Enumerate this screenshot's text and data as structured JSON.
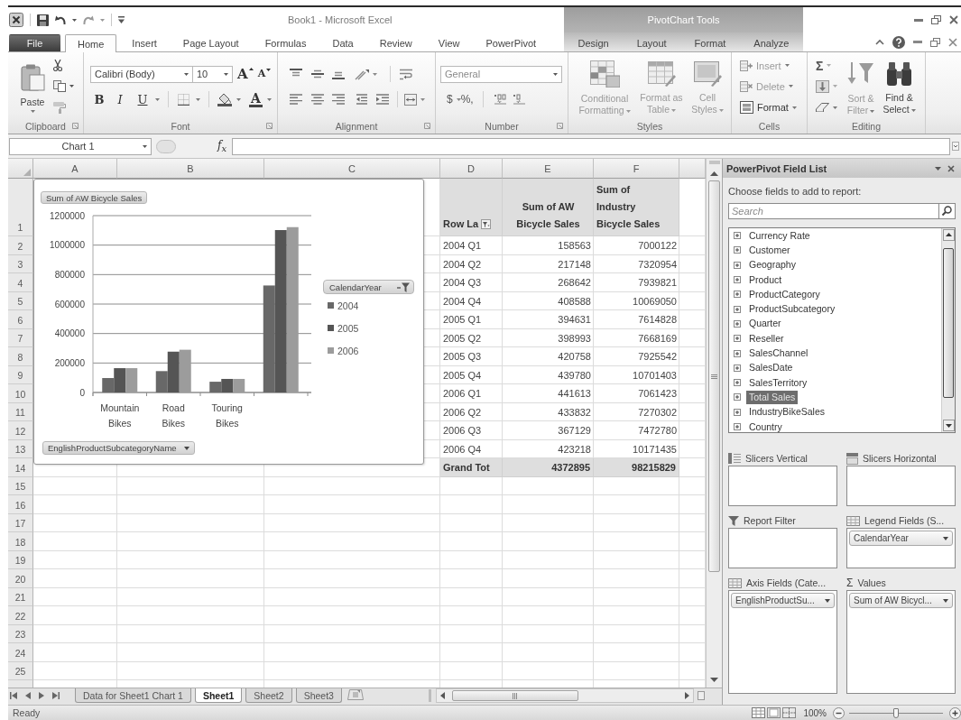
{
  "title_bar": {
    "title": "Book1 - Microsoft Excel",
    "context_header": "PivotChart Tools"
  },
  "ribbon_tabs": [
    {
      "label": "File",
      "kind": "file",
      "selected": false
    },
    {
      "label": "Home",
      "kind": "standard",
      "selected": true
    },
    {
      "label": "Insert",
      "kind": "standard",
      "selected": false
    },
    {
      "label": "Page Layout",
      "kind": "standard",
      "selected": false
    },
    {
      "label": "Formulas",
      "kind": "standard",
      "selected": false
    },
    {
      "label": "Data",
      "kind": "standard",
      "selected": false
    },
    {
      "label": "Review",
      "kind": "standard",
      "selected": false
    },
    {
      "label": "View",
      "kind": "standard",
      "selected": false
    },
    {
      "label": "PowerPivot",
      "kind": "standard",
      "selected": false
    },
    {
      "label": "Design",
      "kind": "contextual",
      "selected": false
    },
    {
      "label": "Layout",
      "kind": "contextual",
      "selected": false
    },
    {
      "label": "Format",
      "kind": "contextual",
      "selected": false
    },
    {
      "label": "Analyze",
      "kind": "contextual",
      "selected": false
    }
  ],
  "ribbon": {
    "clipboard": {
      "label": "Clipboard",
      "paste": "Paste"
    },
    "font": {
      "label": "Font",
      "font_name": "Calibri (Body)",
      "font_size": "10",
      "grow": "A",
      "shrink": "A",
      "bold": "B",
      "italic": "I",
      "underline": "U",
      "font_color": "A"
    },
    "alignment": {
      "label": "Alignment"
    },
    "number": {
      "label": "Number",
      "format": "General",
      "currency": "$",
      "percent": "%",
      "comma": ","
    },
    "styles": {
      "label": "Styles",
      "buttons": [
        {
          "label": "Conditional Formatting",
          "kind": "conditional",
          "disabled": true
        },
        {
          "label": "Format as Table",
          "kind": "table",
          "disabled": true
        },
        {
          "label": "Cell Styles",
          "kind": "cell_styles",
          "disabled": true
        }
      ]
    },
    "cells": {
      "label": "Cells",
      "buttons": [
        {
          "label": "Insert",
          "kind": "insert",
          "disabled": true
        },
        {
          "label": "Delete",
          "kind": "delete",
          "disabled": true
        },
        {
          "label": "Format",
          "kind": "format",
          "disabled": false
        }
      ]
    },
    "editing": {
      "label": "Editing",
      "autosum": "Σ",
      "buttons": [
        {
          "label": "Sort & Filter",
          "kind": "sort",
          "disabled": true
        },
        {
          "label": "Find & Select",
          "kind": "find",
          "disabled": false
        }
      ]
    }
  },
  "formula_bar": {
    "name_box": "Chart 1",
    "function_button": "f$_{x}$"
  },
  "sheet": {
    "columns": [
      "A",
      "B",
      "C",
      "D",
      "E",
      "F"
    ],
    "row_numbers": [
      "1",
      "2",
      "3",
      "4",
      "5",
      "6",
      "7",
      "8",
      "9",
      "10",
      "11",
      "12",
      "13",
      "14",
      "15",
      "16",
      "17",
      "18",
      "19",
      "20",
      "21",
      "22",
      "23",
      "24",
      "25"
    ]
  },
  "chart": {
    "value_field_button": "Sum of AW Bicycle Sales",
    "axis_field_button": "EnglishProductSubcategoryName",
    "chart_data": {
      "type": "bar",
      "categories": [
        "Mountain Bikes",
        "Road Bikes",
        "Touring Bikes",
        null
      ],
      "series": [
        {
          "name": "2004",
          "color": "#686868",
          "values": [
            98000,
            145000,
            73000,
            726000
          ]
        },
        {
          "name": "2005",
          "color": "#555555",
          "values": [
            165000,
            277000,
            92000,
            1102000
          ]
        },
        {
          "name": "2006",
          "color": "#9c9c9c",
          "values": [
            165000,
            290000,
            92000,
            1122000
          ]
        }
      ],
      "ylim": [
        0,
        1200000
      ],
      "yticks": [
        0,
        200000,
        400000,
        600000,
        800000,
        1000000,
        1200000
      ],
      "grid": true,
      "legend": "right",
      "legend_title": "CalendarYear"
    }
  },
  "pivot_table": {
    "headers": [
      "Row La",
      "Sum of AW Bicycle Sales",
      "Sum of Industry Bicycle Sales"
    ],
    "rows": [
      {
        "label": "2004 Q1",
        "values": [
          "158563",
          "7000122"
        ]
      },
      {
        "label": "2004 Q2",
        "values": [
          "217148",
          "7320954"
        ]
      },
      {
        "label": "2004 Q3",
        "values": [
          "268642",
          "7939821"
        ]
      },
      {
        "label": "2004 Q4",
        "values": [
          "408588",
          "10069050"
        ]
      },
      {
        "label": "2005 Q1",
        "values": [
          "394631",
          "7614828"
        ]
      },
      {
        "label": "2005 Q2",
        "values": [
          "398993",
          "7668169"
        ]
      },
      {
        "label": "2005 Q3",
        "values": [
          "420758",
          "7925542"
        ]
      },
      {
        "label": "2005 Q4",
        "values": [
          "439780",
          "10701403"
        ]
      },
      {
        "label": "2006 Q1",
        "values": [
          "441613",
          "7061423"
        ]
      },
      {
        "label": "2006 Q2",
        "values": [
          "433832",
          "7270302"
        ]
      },
      {
        "label": "2006 Q3",
        "values": [
          "367129",
          "7472780"
        ]
      },
      {
        "label": "2006 Q4",
        "values": [
          "423218",
          "10171435"
        ]
      }
    ],
    "grand_total": {
      "label": "Grand Tot",
      "values": [
        "4372895",
        "98215829"
      ]
    }
  },
  "field_list": {
    "title": "PowerPivot Field List",
    "prompt": "Choose fields to add to report:",
    "search": {
      "placeholder": "Search"
    },
    "fields": [
      {
        "label": "Currency Rate",
        "selected": false
      },
      {
        "label": "Customer",
        "selected": false
      },
      {
        "label": "Geography",
        "selected": false
      },
      {
        "label": "Product",
        "selected": false
      },
      {
        "label": "ProductCategory",
        "selected": false
      },
      {
        "label": "ProductSubcategory",
        "selected": false
      },
      {
        "label": "Quarter",
        "selected": false
      },
      {
        "label": "Reseller",
        "selected": false
      },
      {
        "label": "SalesChannel",
        "selected": false
      },
      {
        "label": "SalesDate",
        "selected": false
      },
      {
        "label": "SalesTerritory",
        "selected": false
      },
      {
        "label": "Total Sales",
        "selected": true
      },
      {
        "label": "IndustryBikeSales",
        "selected": false
      },
      {
        "label": "Country",
        "selected": false
      }
    ],
    "areas": [
      {
        "kind": "slicers_vertical",
        "label": "Slicers Vertical"
      },
      {
        "kind": "slicers_horizontal",
        "label": "Slicers Horizontal"
      },
      {
        "kind": "report_filter",
        "label": "Report Filter"
      },
      {
        "kind": "legend",
        "label": "Legend Fields (S...",
        "items": [
          "CalendarYear"
        ]
      },
      {
        "kind": "axis",
        "label": "Axis Fields (Cate...",
        "items": [
          "EnglishProductSu..."
        ]
      },
      {
        "kind": "values",
        "symbol": "Σ",
        "label": "Values",
        "items": [
          "Sum of AW Bicycl..."
        ]
      }
    ]
  },
  "sheet_tabs": [
    {
      "label": "Data for Sheet1 Chart 1",
      "selected": false
    },
    {
      "label": "Sheet1",
      "selected": true
    },
    {
      "label": "Sheet2",
      "selected": false
    },
    {
      "label": "Sheet3",
      "selected": false
    }
  ],
  "status_bar": {
    "status": "Ready",
    "zoom": "100%",
    "zoom_slider": {
      "level": 0.5
    }
  }
}
